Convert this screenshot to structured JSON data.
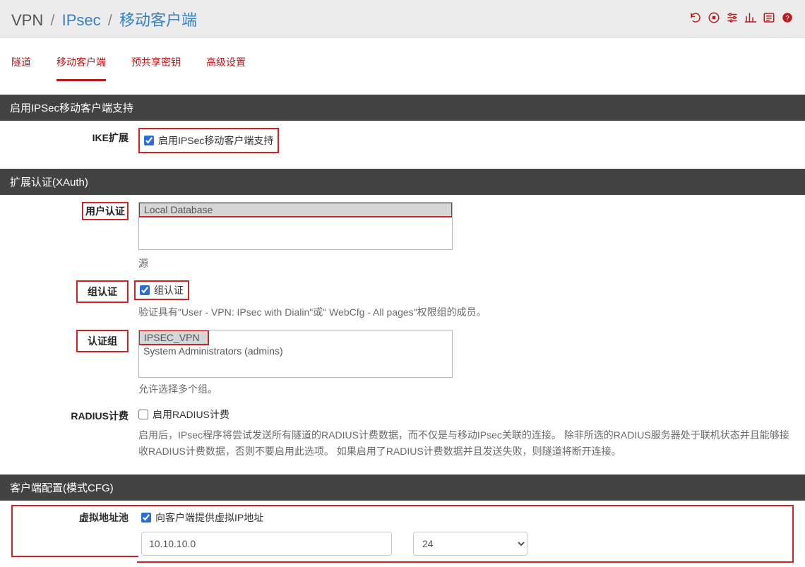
{
  "breadcrumb": {
    "l1": "VPN",
    "l2": "IPsec",
    "l3": "移动客户端"
  },
  "tabs": [
    "隧道",
    "移动客户端",
    "预共享密钥",
    "高级设置"
  ],
  "active_tab": 1,
  "sections": {
    "enable": {
      "title": "启用IPSec移动客户端支持",
      "ike_label": "IKE扩展",
      "ike_checkbox_label": "启用IPSec移动客户端支持",
      "ike_checked": true
    },
    "xauth": {
      "title": "扩展认证(XAuth)",
      "user_auth_label": "用户认证",
      "user_auth_options": [
        "Local Database"
      ],
      "user_auth_selected": 0,
      "user_auth_sub": "源",
      "group_auth_label": "组认证",
      "group_auth_checkbox_label": "组认证",
      "group_auth_checked": true,
      "group_auth_help": "验证具有\"User - VPN: IPsec with Dialin\"或\" WebCfg - All pages\"权限组的成员。",
      "auth_group_label": "认证组",
      "auth_group_options": [
        "IPSEC_VPN",
        "System Administrators (admins)"
      ],
      "auth_group_selected": 0,
      "auth_group_help": "允许选择多个组。",
      "radius_label": "RADIUS计费",
      "radius_checkbox_label": "启用RADIUS计费",
      "radius_checked": false,
      "radius_help": "启用后，IPsec程序将尝试发送所有隧道的RADIUS计费数据，而不仅是与移动IPsec关联的连接。 除非所选的RADIUS服务器处于联机状态并且能够接收RADIUS计费数据，否则不要启用此选项。 如果启用了RADIUS计费数据并且发送失败，则隧道将断开连接。"
    },
    "client": {
      "title": "客户端配置(模式CFG)",
      "vpool_label": "虚拟地址池",
      "vpool_checkbox_label": "向客户端提供虚拟IP地址",
      "vpool_checked": true,
      "vpool_ip": "10.10.10.0",
      "vpool_mask": "24"
    }
  },
  "icons": [
    "refresh",
    "stop",
    "sliders",
    "chart",
    "list",
    "help"
  ]
}
